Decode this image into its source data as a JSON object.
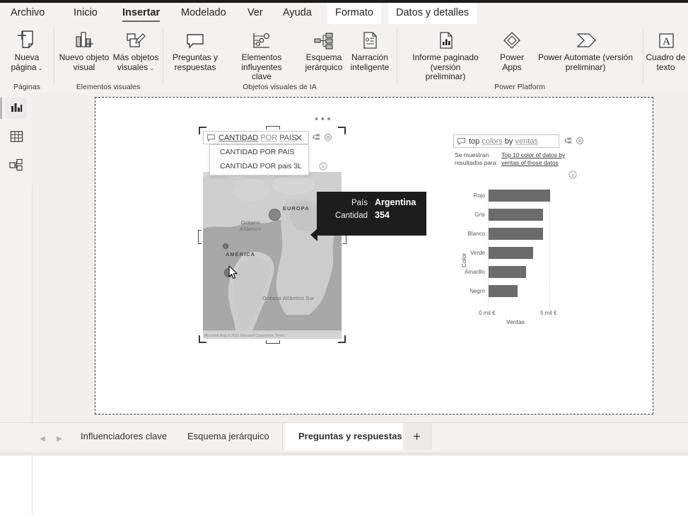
{
  "menu": {
    "tabs": [
      {
        "label": "Archivo",
        "state": "normal"
      },
      {
        "label": "Inicio",
        "state": "normal"
      },
      {
        "label": "Insertar",
        "state": "selected"
      },
      {
        "label": "Modelado",
        "state": "normal"
      },
      {
        "label": "Ver",
        "state": "normal"
      },
      {
        "label": "Ayuda",
        "state": "normal"
      },
      {
        "label": "Formato",
        "state": "contextual"
      },
      {
        "label": "Datos y detalles",
        "state": "contextual"
      }
    ]
  },
  "ribbon": {
    "groups": [
      {
        "label": "Páginas",
        "items": [
          {
            "label": "Nueva\npágina",
            "icon": "new-page-icon",
            "caret": true
          }
        ]
      },
      {
        "label": "Elementos visuales",
        "items": [
          {
            "label": "Nuevo objeto\nvisual",
            "icon": "new-visual-icon",
            "caret": false
          },
          {
            "label": "Más objetos\nvisuales",
            "icon": "more-visuals-icon",
            "caret": true
          }
        ]
      },
      {
        "label": "Objetos visuales de IA",
        "items": [
          {
            "label": "Preguntas y\nrespuestas",
            "icon": "qna-icon",
            "caret": false
          },
          {
            "label": "Elementos influyentes\nclave",
            "icon": "key-influencers-icon",
            "caret": false
          },
          {
            "label": "Esquema\njerárquico",
            "icon": "decomposition-tree-icon",
            "caret": false
          },
          {
            "label": "Narración\ninteligente",
            "icon": "smart-narrative-icon",
            "caret": false
          }
        ]
      },
      {
        "label": "Power Platform",
        "items": [
          {
            "label": "Informe paginado (versión\npreliminar)",
            "icon": "paginated-report-icon",
            "caret": false
          },
          {
            "label": "Power\nApps",
            "icon": "power-apps-icon",
            "caret": false
          },
          {
            "label": "Power Automate (versión\npreliminar)",
            "icon": "power-automate-icon",
            "caret": false
          }
        ]
      },
      {
        "label": "",
        "items": [
          {
            "label": "Cuadro de\ntexto",
            "icon": "text-box-icon",
            "caret": false
          }
        ]
      }
    ]
  },
  "rail": {
    "items": [
      {
        "name": "report-view",
        "icon": "report-bar-chart-icon",
        "active": true
      },
      {
        "name": "data-view",
        "icon": "data-table-icon",
        "active": false
      },
      {
        "name": "model-view",
        "icon": "model-relationships-icon",
        "active": false
      }
    ]
  },
  "qna_map_visual": {
    "more_options": "•••",
    "input_value": "CANTIDAD POR PAIS",
    "input_tokens": [
      {
        "text": "CANTIDAD",
        "style": "underline"
      },
      {
        "text": "POR",
        "style": "grey-underline"
      },
      {
        "text": "PAIS",
        "style": "grey-underline-bold"
      }
    ],
    "clear_icon": "close-icon",
    "convert_icon": "convert-to-visual-icon",
    "settings_icon": "gear-icon",
    "info_icon": "info-icon",
    "suggestions": [
      "CANTIDAD POR PAIS",
      "CANTIDAD POR pais 3L"
    ],
    "map": {
      "labels": [
        {
          "text": "EUROPA",
          "type": "continent"
        },
        {
          "text": "Océano",
          "type": "ocean"
        },
        {
          "text": "Atlántico",
          "type": "ocean"
        },
        {
          "text": "AMÉRICA",
          "type": "continent"
        },
        {
          "text": "Océano Atlántico Sur",
          "type": "ocean"
        }
      ],
      "attribution": "Microsoft Bing © 2021 Microsoft Corporation   Terms"
    },
    "tooltip": {
      "rows": [
        {
          "key": "País",
          "value": "Argentina"
        },
        {
          "key": "Cantidad",
          "value": "354"
        }
      ]
    }
  },
  "qna_chart_visual": {
    "input_value": "top colors by ventas",
    "input_tokens": [
      {
        "text": "top",
        "style": "plain"
      },
      {
        "text": "colors",
        "style": "grey-underline"
      },
      {
        "text": "by",
        "style": "plain"
      },
      {
        "text": "ventas",
        "style": "grey-underline"
      }
    ],
    "convert_icon": "convert-to-visual-icon",
    "settings_icon": "gear-icon",
    "info_icon": "info-icon",
    "results_label_line1": "Se muestran",
    "results_label_line2": "resultados para:",
    "results_value_line1": "Top 10 color of datos by",
    "results_value_line2": "ventas of those datos"
  },
  "chart_data": {
    "type": "bar",
    "orientation": "horizontal",
    "title": "",
    "xlabel": "Ventas",
    "ylabel": "Color",
    "categories": [
      "Rojo",
      "Gris",
      "Blanco",
      "Verde",
      "Amarillo",
      "Negro"
    ],
    "values": [
      5000,
      4400,
      4400,
      3600,
      3050,
      2350
    ],
    "xlim": [
      0,
      5700
    ],
    "xticks": [
      0,
      5000
    ],
    "xticklabels": [
      "0 mil €",
      "5 mil €"
    ],
    "grid": true,
    "legend": false,
    "bar_color": "#6b6b6b"
  },
  "tabbar": {
    "prev_icon": "chevron-left-icon",
    "next_icon": "chevron-right-icon",
    "tabs": [
      {
        "label": "Influenciadores clave",
        "selected": false
      },
      {
        "label": "Esquema jerárquico",
        "selected": false
      },
      {
        "label": "Preguntas y respuestas",
        "selected": true
      }
    ],
    "add_tab_label": "+"
  }
}
